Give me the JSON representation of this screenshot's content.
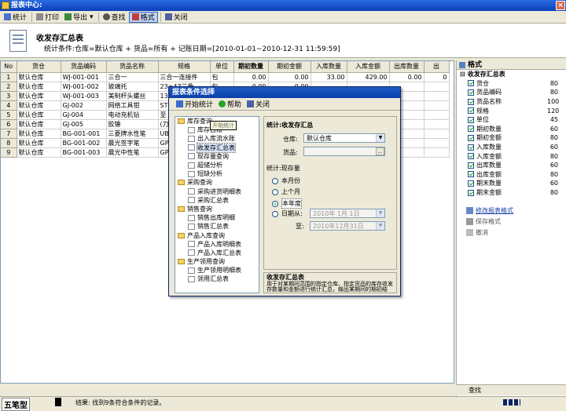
{
  "window": {
    "title": "报表中心:"
  },
  "toolbar": {
    "buttons": [
      {
        "label": "统计",
        "icon": "statistics-icon"
      },
      {
        "label": "打印",
        "icon": "printer-icon"
      },
      {
        "label": "导出",
        "icon": "export-icon"
      },
      {
        "label": "查找",
        "icon": "binoculars-icon"
      },
      {
        "label": "格式",
        "icon": "format-icon"
      },
      {
        "label": "关闭",
        "icon": "close-icon"
      }
    ]
  },
  "header": {
    "title": "收发存汇总表",
    "subtitle": "统计条件:仓库=默认仓库 + 货品=所有 + 记账日期=[2010-01-01~2010-12-31 11:59:59]"
  },
  "grid": {
    "columns": [
      "No",
      "货仓",
      "货品编码",
      "货品名称",
      "规格",
      "单位",
      "期初数量",
      "期初金额",
      "入库数量",
      "入库金额",
      "出库数量",
      "出"
    ],
    "rows": [
      [
        "1",
        "默认仓库",
        "WJ-001-001",
        "三合一",
        "三合一连接件",
        "包",
        "0.00",
        "0.00",
        "33.00",
        "429.00",
        "0.00",
        "0"
      ],
      [
        "2",
        "默认仓库",
        "WJ-001-002",
        "玻璃托",
        "23×47三角",
        "包",
        "0.00",
        "0.00",
        "",
        "",
        "",
        ""
      ],
      [
        "3",
        "默认仓库",
        "WJ-001-003",
        "美制杆头螺丝",
        "13",
        "",
        "",
        "",
        "",
        "",
        "",
        ""
      ],
      [
        "4",
        "默认仓库",
        "GJ-002",
        "网络工具钳",
        "ST",
        "",
        "",
        "",
        "",
        "",
        "",
        ""
      ],
      [
        "5",
        "默认仓库",
        "GJ-004",
        "电动充机钻",
        "至",
        "",
        "",
        "",
        "",
        "",
        "",
        ""
      ],
      [
        "6",
        "默认仓库",
        "GJ-005",
        "胶锤",
        "(刀",
        "",
        "",
        "",
        "",
        "",
        "",
        ""
      ],
      [
        "7",
        "默认仓库",
        "BG-001-001",
        "三菱牌水性笔",
        "UB",
        "",
        "",
        "",
        "",
        "",
        "",
        ""
      ],
      [
        "8",
        "默认仓库",
        "BG-001-002",
        "晨光签字笔",
        "GP",
        "",
        "",
        "",
        "",
        "",
        "",
        ""
      ],
      [
        "9",
        "默认仓库",
        "BG-001-003",
        "晨光中性笔",
        "GP",
        "",
        "",
        "",
        "",
        "",
        "",
        ""
      ]
    ]
  },
  "format_panel": {
    "title": "格式",
    "group": "收发存汇总表",
    "fields": [
      {
        "label": "货仓",
        "width": "80"
      },
      {
        "label": "货品编码",
        "width": "80"
      },
      {
        "label": "货品名称",
        "width": "100"
      },
      {
        "label": "规格",
        "width": "120"
      },
      {
        "label": "单位",
        "width": "45"
      },
      {
        "label": "期初数量",
        "width": "60"
      },
      {
        "label": "期初金额",
        "width": "80"
      },
      {
        "label": "入库数量",
        "width": "60"
      },
      {
        "label": "入库金额",
        "width": "80"
      },
      {
        "label": "出库数量",
        "width": "60"
      },
      {
        "label": "出库金额",
        "width": "80"
      },
      {
        "label": "期末数量",
        "width": "60"
      },
      {
        "label": "期末金额",
        "width": "80"
      }
    ],
    "actions": [
      "修改报表格式",
      "保存格式",
      "撤消"
    ],
    "find_label": "查找"
  },
  "dialog": {
    "title": "报表条件选择",
    "toolbar": [
      "开始统计",
      "帮助",
      "关闭"
    ],
    "tooltip": "开始统计",
    "tree": [
      {
        "label": "库存查询",
        "folder": true
      },
      {
        "label": "库存台账",
        "folder": false
      },
      {
        "label": "出入库流水账",
        "folder": false
      },
      {
        "label": "收发存汇总表",
        "folder": false,
        "selected": true
      },
      {
        "label": "现存量查询",
        "folder": false
      },
      {
        "label": "超储分析",
        "folder": false
      },
      {
        "label": "短缺分析",
        "folder": false
      },
      {
        "label": "采购查询",
        "folder": true
      },
      {
        "label": "采购进货明细表",
        "folder": false
      },
      {
        "label": "采购汇总表",
        "folder": false
      },
      {
        "label": "销售查询",
        "folder": true
      },
      {
        "label": "销售出库明细",
        "folder": false
      },
      {
        "label": "销售汇总表",
        "folder": false
      },
      {
        "label": "产品入库查询",
        "folder": true
      },
      {
        "label": "产品入库明细表",
        "folder": false
      },
      {
        "label": "产品入库汇总表",
        "folder": false
      },
      {
        "label": "生产领用查询",
        "folder": true
      },
      {
        "label": "生产领用明细表",
        "folder": false
      },
      {
        "label": "领用汇总表",
        "folder": false
      }
    ],
    "section_title": "统计:收发存汇总",
    "warehouse_label": "仓库:",
    "warehouse_value": "默认仓库",
    "goods_label": "货品:",
    "goods_value": "",
    "period_title": "统计:现存量",
    "radios": [
      {
        "label": "本月份",
        "checked": false
      },
      {
        "label": "上个月",
        "checked": false
      },
      {
        "label": "本年度",
        "checked": true
      },
      {
        "label": "日期从:",
        "checked": false
      }
    ],
    "date_from": "2010年 1月 1日",
    "date_to_label": "至:",
    "date_to": "2010年12月31日",
    "desc_title": "收发存汇总表",
    "desc_text": "用于对某期间范围的指定仓库、指定货品的库存收发存数量和金额进行统计汇总，输出某期间的期初结存、入库、出库、期末结存的总数量/总金额。"
  },
  "status": {
    "ime": "五笔型",
    "text": "结果: 找到9条符合条件的记录。"
  }
}
